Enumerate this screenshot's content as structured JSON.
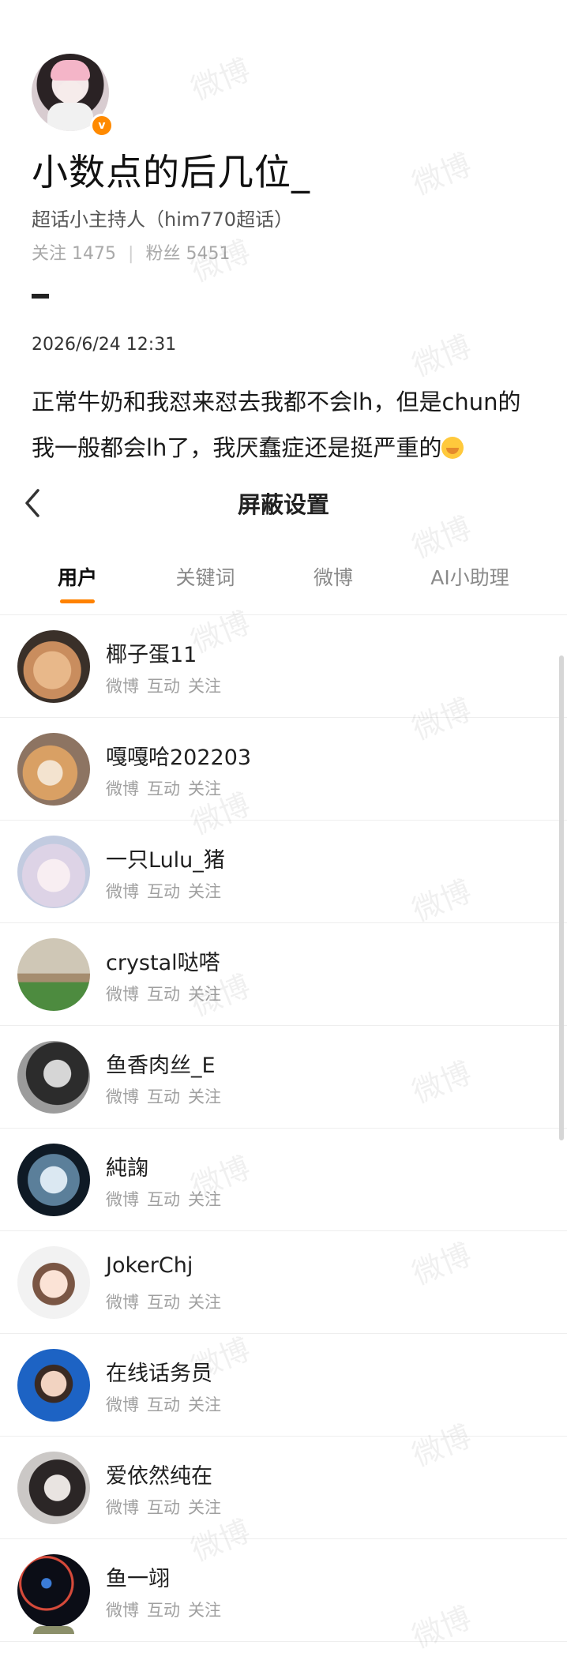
{
  "post": {
    "name": "小数点的后几位_",
    "role": "超话小主持人（him770超话）",
    "following_label": "关注",
    "following_count": "1475",
    "followers_label": "粉丝",
    "followers_count": "5451",
    "date": "2026/6/24 12:31",
    "text": "正常牛奶和我怼来怼去我都不会lh，但是chun的我一般都会lh了，我厌蠢症还是挺严重的",
    "badge_color": "#ff8a00"
  },
  "settings": {
    "title": "屏蔽设置",
    "back_icon": "chevron-left-icon",
    "tabs": [
      {
        "label": "用户",
        "active": true
      },
      {
        "label": "关键词",
        "active": false
      },
      {
        "label": "微博",
        "active": false
      },
      {
        "label": "AI小助理",
        "active": false
      }
    ],
    "accent_color": "#ff8200",
    "users": [
      {
        "name": "椰子蛋11",
        "actions": [
          "微博",
          "互动",
          "关注"
        ]
      },
      {
        "name": "嘎嘎哈202203",
        "actions": [
          "微博",
          "互动",
          "关注"
        ]
      },
      {
        "name": "一只Lulu_猪",
        "actions": [
          "微博",
          "互动",
          "关注"
        ]
      },
      {
        "name": "crystal哒嗒",
        "actions": [
          "微博",
          "互动",
          "关注"
        ]
      },
      {
        "name": "鱼香肉丝_E",
        "actions": [
          "微博",
          "互动",
          "关注"
        ]
      },
      {
        "name": "純諊",
        "actions": [
          "微博",
          "互动",
          "关注"
        ]
      },
      {
        "name": "JokerChj",
        "actions": [
          "微博",
          "互动",
          "关注"
        ]
      },
      {
        "name": "在线话务员",
        "actions": [
          "微博",
          "互动",
          "关注"
        ]
      },
      {
        "name": "爱依然纯在",
        "actions": [
          "微博",
          "互动",
          "关注"
        ]
      },
      {
        "name": "鱼一翊",
        "actions": [
          "微博",
          "互动",
          "关注"
        ]
      }
    ]
  },
  "watermark": "微博"
}
